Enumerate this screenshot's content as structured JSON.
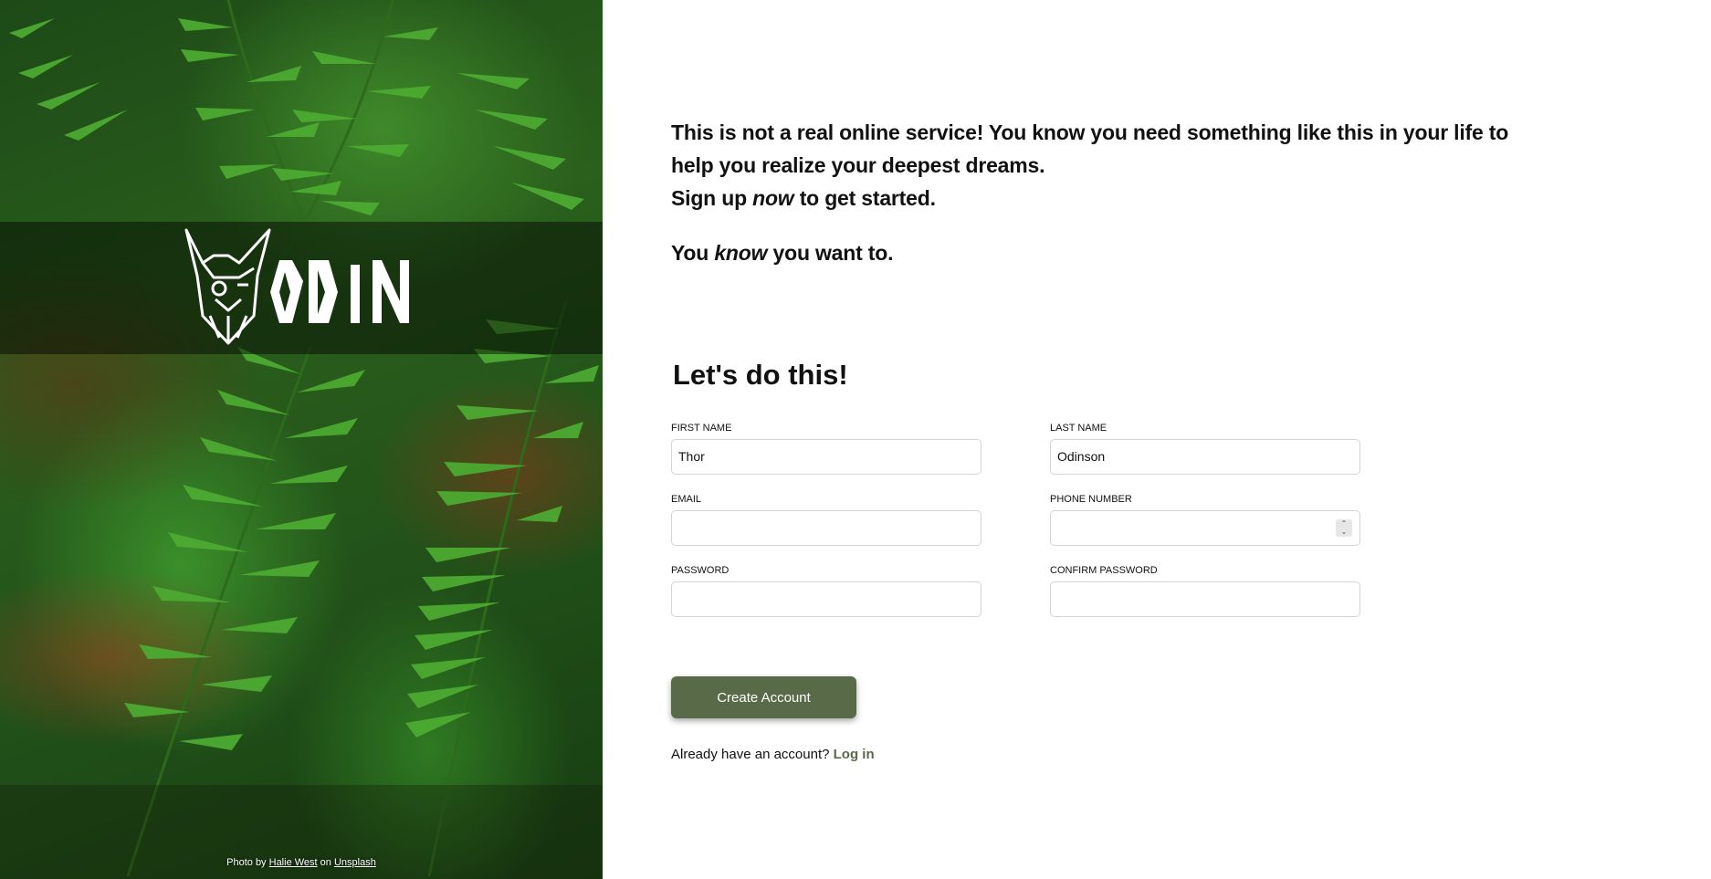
{
  "hero": {
    "logo_text": "ODIN",
    "credit_prefix": "Photo by",
    "credit_author": "Halie West",
    "credit_on": "on",
    "credit_site": "Unsplash"
  },
  "intro": {
    "line1": "This is not a real online service! You know you need something like this in your life to help you realize your deepest dreams.",
    "signup_before": "Sign up ",
    "signup_em": "now",
    "signup_after": " to get started.",
    "know_before": "You ",
    "know_em": "know",
    "know_after": " you want to."
  },
  "form": {
    "title": "Let's do this!",
    "first_name": {
      "label": "FIRST NAME",
      "value": "Thor"
    },
    "last_name": {
      "label": "LAST NAME",
      "value": "Odinson"
    },
    "email": {
      "label": "EMAIL",
      "value": ""
    },
    "phone": {
      "label": "PHONE NUMBER",
      "value": ""
    },
    "password": {
      "label": "PASSWORD",
      "value": ""
    },
    "confirm_password": {
      "label": "CONFIRM PASSWORD",
      "value": ""
    },
    "submit_label": "Create Account",
    "login_prompt": "Already have an account?",
    "login_link": "Log in"
  },
  "colors": {
    "accent": "#596a48",
    "text": "#111111",
    "input_border": "#d4d4d4"
  }
}
